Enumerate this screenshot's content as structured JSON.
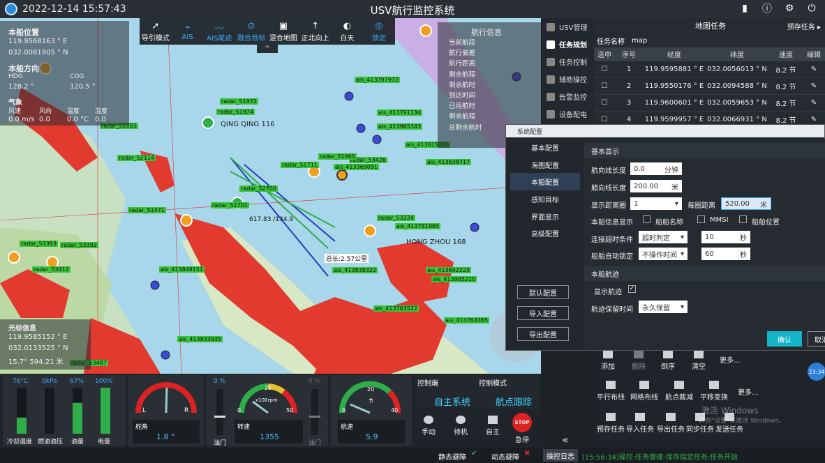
{
  "window": {
    "title": "USV航行监控系统",
    "datetime": "2022-12-14 15:57:43"
  },
  "toolbar": {
    "items": [
      "导引模式",
      "AIS",
      "AIS尾迹",
      "融合目标",
      "混合地图",
      "正北向上",
      "白天",
      "锁定"
    ]
  },
  "own_ship": {
    "title": "本船位置",
    "lon": "119.9568163 ° E",
    "lat": "032.0081905 ° N",
    "dir_title": "本船方向",
    "hdg_label": "HDG",
    "hdg_value": "128.2 °",
    "cog_label": "COG",
    "cog_value": "120.5 °"
  },
  "weather": {
    "title": "气象",
    "items": [
      {
        "label": "风速",
        "value": "0.0 m/s"
      },
      {
        "label": "风向",
        "value": "0.0"
      },
      {
        "label": "温度",
        "value": "0.0 °C"
      },
      {
        "label": "湿度",
        "value": "0.0"
      }
    ]
  },
  "cursor": {
    "title": "光标信息",
    "lon": "119.9585152 ° E",
    "lat": "032.0133525 ° N",
    "extra": "15.7°   594.21 米"
  },
  "nav_info": {
    "title": "航行信息",
    "labels": [
      "当前航段",
      "航行偏差",
      "航行距离",
      "剩余航程",
      "剩余航时",
      "到达时间",
      "已用航时",
      "剩余航程",
      "总剩余航时"
    ]
  },
  "map_labels": [
    "radar_51972",
    "ais_413797972",
    "radar_51974",
    "ais_413791134",
    "radar_52203",
    "ais_413965343",
    "ais_413815035",
    "radar_52114",
    "radar_51711",
    "ais_413369091",
    "radar_53426",
    "ais_413838717",
    "radar_51960",
    "radar_52700",
    "radar_51471",
    "radar_52701",
    "radar_53224",
    "ais_413781965",
    "radar_53393",
    "radar_53392",
    "ais_413849151",
    "ais_413842223",
    "ais_413965210",
    "radar_53412",
    "ais_413838322",
    "ais_413763522",
    "ais_413833935",
    "radar_53487",
    "ais_413764365",
    "QING QING 116",
    "HONG ZHOU 168",
    "617.83 /134.9",
    "总长:2.57公里"
  ],
  "side_nav": {
    "items": [
      "USV管理",
      "任务规划",
      "任务控制",
      "辅助操控",
      "告警监控",
      "设备配电"
    ],
    "active": 1
  },
  "task_panel": {
    "title": "地图任务",
    "preset_btn": "预存任务",
    "name_label": "任务名称",
    "name_value": "map",
    "columns": [
      "选中",
      "序号",
      "经度",
      "纬度",
      "速度",
      "编辑"
    ],
    "rows": [
      {
        "no": "1",
        "lon": "119.9595881 ° E",
        "lat": "032.0056013 ° N",
        "speed": "8.2 节"
      },
      {
        "no": "2",
        "lon": "119.9550176 ° E",
        "lat": "032.0094588 ° N",
        "speed": "8.2 节"
      },
      {
        "no": "3",
        "lon": "119.9600601 ° E",
        "lat": "032.0059653 ° N",
        "speed": "8.2 节"
      },
      {
        "no": "4",
        "lon": "119.9599957 ° E",
        "lat": "032.0066931 ° N",
        "speed": "8.2 节"
      }
    ]
  },
  "dialog": {
    "title": "系统配置",
    "nav": [
      "基本配置",
      "海图配置",
      "本船配置",
      "感知目标",
      "界面显示",
      "高级配置"
    ],
    "nav_active": 2,
    "buttons": [
      "默认配置",
      "导入配置",
      "导出配置"
    ],
    "sec1": "基本显示",
    "course_len_label": "航向线长度",
    "course_len_value": "0.0",
    "course_len_unit": "分钟",
    "heading_len_label": "艏向线长度",
    "heading_len_value": "200.00",
    "heading_len_unit": "米",
    "range_label": "显示距离圈",
    "range_value": "1",
    "ring_label": "每圈距离",
    "ring_value": "520.00",
    "ring_unit": "米",
    "info_label": "本船信息显示",
    "info_opts": [
      "船舶名称",
      "MMSI",
      "船舶位置"
    ],
    "timeout_label": "连接超时条件",
    "timeout_value": "超时判定",
    "timeout_num": "10",
    "timeout_unit": "秒",
    "autolock_label": "船舶自动锁定",
    "autolock_value": "不操作时间",
    "autolock_num": "60",
    "autolock_unit": "秒",
    "sec2": "本船航迹",
    "show_track": "显示航迹",
    "track_time_label": "航迹保留时间",
    "track_time_value": "永久保留",
    "confirm": "确认",
    "cancel": "取消"
  },
  "gauges": {
    "tank_labels": [
      "冷却温度",
      "燃油油压",
      "油量",
      "电量"
    ],
    "tank_values": [
      "76°C",
      "0kPa",
      "67%",
      "100%"
    ],
    "tank_levels": [
      0.35,
      0,
      0.67,
      1.0
    ],
    "rudder_label": "舵角",
    "rudder_value": "1.8 °",
    "rudder_l": "L",
    "rudder_r": "R",
    "throttle_label": "油门",
    "throttle_top": "0 %",
    "rpm_label": "转速",
    "rpm_value": "1355",
    "rpm_unit": "x100rpm",
    "rpm_ticks": [
      "0",
      "25",
      "50"
    ],
    "throttle2_label": "油门",
    "throttle2_top": "0 %",
    "speed_label": "航速",
    "speed_value": "5.9",
    "speed_ticks": [
      "0",
      "20",
      "40"
    ],
    "speed_unit": "节"
  },
  "control": {
    "end_label": "控制端",
    "end_value": "自主系统",
    "mode_label": "控制模式",
    "mode_value": "航点跟踪",
    "buttons": [
      "手动",
      "待机",
      "自主",
      "急停"
    ],
    "stop_text": "STOP"
  },
  "right_tools": {
    "row1": [
      "添加",
      "删除",
      "倒序",
      "清空",
      "更多..."
    ],
    "row2": [
      "平行布线",
      "网格布线",
      "航点裁减",
      "平移变换",
      "更多..."
    ],
    "row3": [
      "预存任务",
      "导入任务",
      "导出任务",
      "同步任务",
      "发送任务"
    ],
    "watermark1": "激活 Windows",
    "watermark2": "转到\"设置\"以激活 Windows。",
    "clock": "23:34"
  },
  "status": {
    "static": "静态避障",
    "dynamic": "动态避障",
    "log_label": "操控日志",
    "log_text": "[15:56:34]操控:任务管理-保存指定任务:任务开始"
  },
  "colors": {
    "accent": "#3fa9f5",
    "green": "#2fae4a",
    "land": "#e23a2f"
  }
}
